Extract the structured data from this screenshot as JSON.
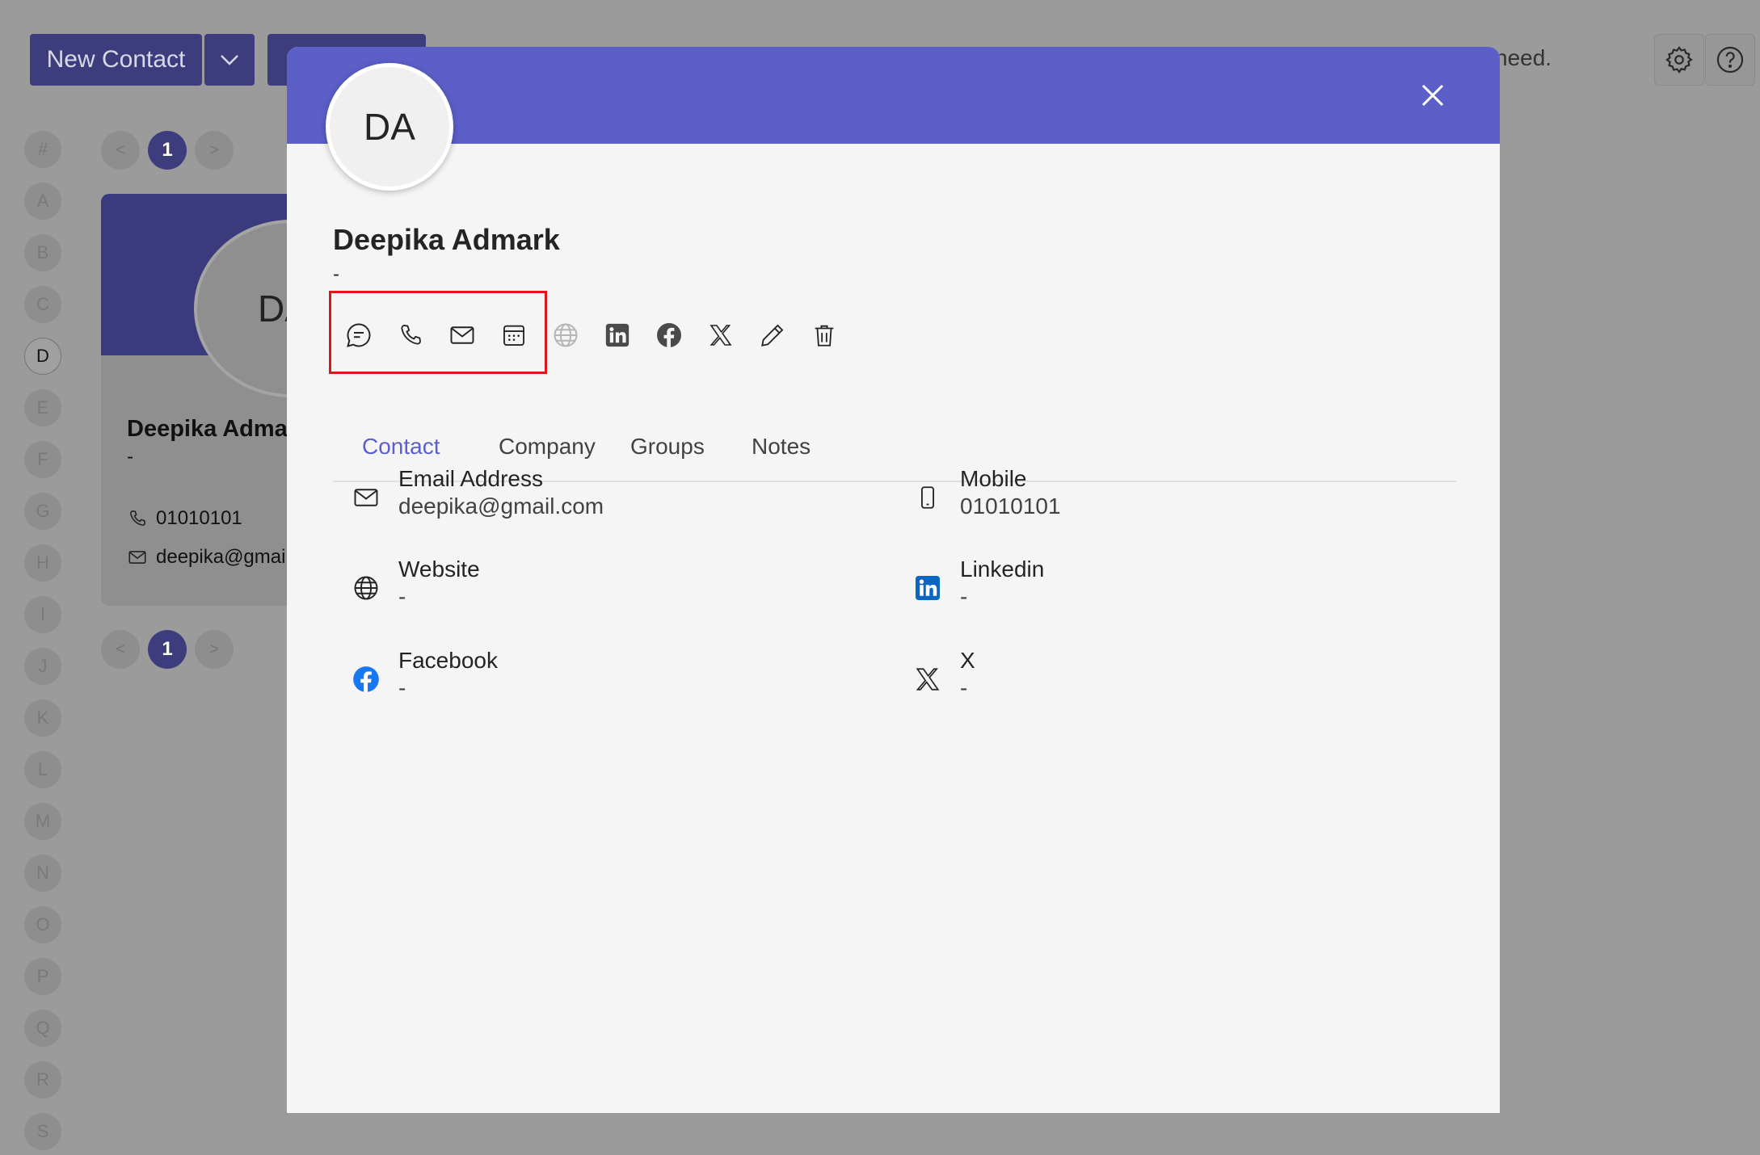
{
  "background": {
    "new_contact_label": "New Contact",
    "notice_fragment": "need.",
    "alphabet": [
      "#",
      "A",
      "B",
      "C",
      "D",
      "E",
      "F",
      "G",
      "H",
      "I",
      "J",
      "K",
      "L",
      "M",
      "N",
      "O",
      "P",
      "Q",
      "R",
      "S"
    ],
    "active_letter": "D",
    "page_current": "1",
    "page_prev": "<",
    "page_next": ">",
    "card": {
      "avatar_initials": "DA",
      "name": "Deepika Admark",
      "subtitle": "-",
      "phone": "01010101",
      "email": "deepika@gmail.com"
    }
  },
  "modal": {
    "avatar_initials": "DA",
    "name": "Deepika Admark",
    "subtitle": "-",
    "accent_color": "#5b5fc7",
    "actions": [
      "chat-icon",
      "phone-icon",
      "mail-icon",
      "calendar-icon",
      "globe-icon",
      "linkedin-icon",
      "facebook-icon",
      "x-icon",
      "edit-icon",
      "delete-icon"
    ],
    "tabs": [
      {
        "label": "Contact",
        "active": true
      },
      {
        "label": "Company",
        "active": false
      },
      {
        "label": "Groups",
        "active": false
      },
      {
        "label": "Notes",
        "active": false
      }
    ],
    "fields": {
      "email": {
        "label": "Email Address",
        "value": "deepika@gmail.com"
      },
      "mobile": {
        "label": "Mobile",
        "value": "01010101"
      },
      "website": {
        "label": "Website",
        "value": "-"
      },
      "linkedin": {
        "label": "Linkedin",
        "value": "-"
      },
      "facebook": {
        "label": "Facebook",
        "value": "-"
      },
      "x": {
        "label": "X",
        "value": "-"
      }
    }
  }
}
